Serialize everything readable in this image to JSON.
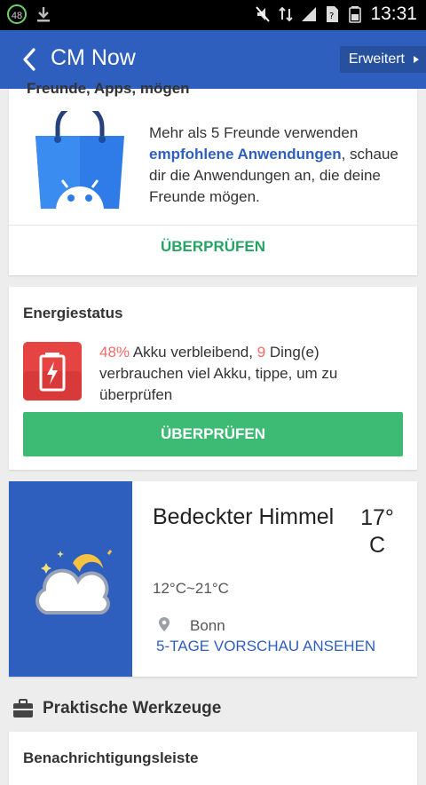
{
  "status_bar": {
    "battery_level": "48",
    "time": "13:31"
  },
  "app_bar": {
    "title": "CM Now",
    "advanced_label": "Erweitert"
  },
  "friends_card": {
    "cut_title": "Freunde, Apps, mögen",
    "text_before": "Mehr als 5 Freunde verwenden ",
    "highlight": "empfohlene Anwendungen",
    "text_after": ", schaue dir die Anwendungen an, die deine Freunde mögen.",
    "check_label": "ÜBERPRÜFEN"
  },
  "energy_card": {
    "heading": "Energiestatus",
    "percent": "48%",
    "text_a": " Akku verbleibend, ",
    "count": "9",
    "text_b": " Ding(e) verbrauchen viel Akku, tippe, um zu überprüfen",
    "button_label": "ÜBERPRÜFEN"
  },
  "weather_card": {
    "condition": "Bedeckter Himmel",
    "temperature": "17°",
    "unit": "C",
    "range": "12°C~21°C",
    "city": "Bonn",
    "forecast_link": "5-TAGE VORSCHAU ANSEHEN"
  },
  "tools_section": {
    "title": "Praktische Werkzeuge"
  },
  "notification_card": {
    "cut_title": "Benachrichtigungsleiste"
  },
  "colors": {
    "primary_blue": "#2f5fbe",
    "green": "#3dbb75",
    "battery_red": "#e64343"
  }
}
